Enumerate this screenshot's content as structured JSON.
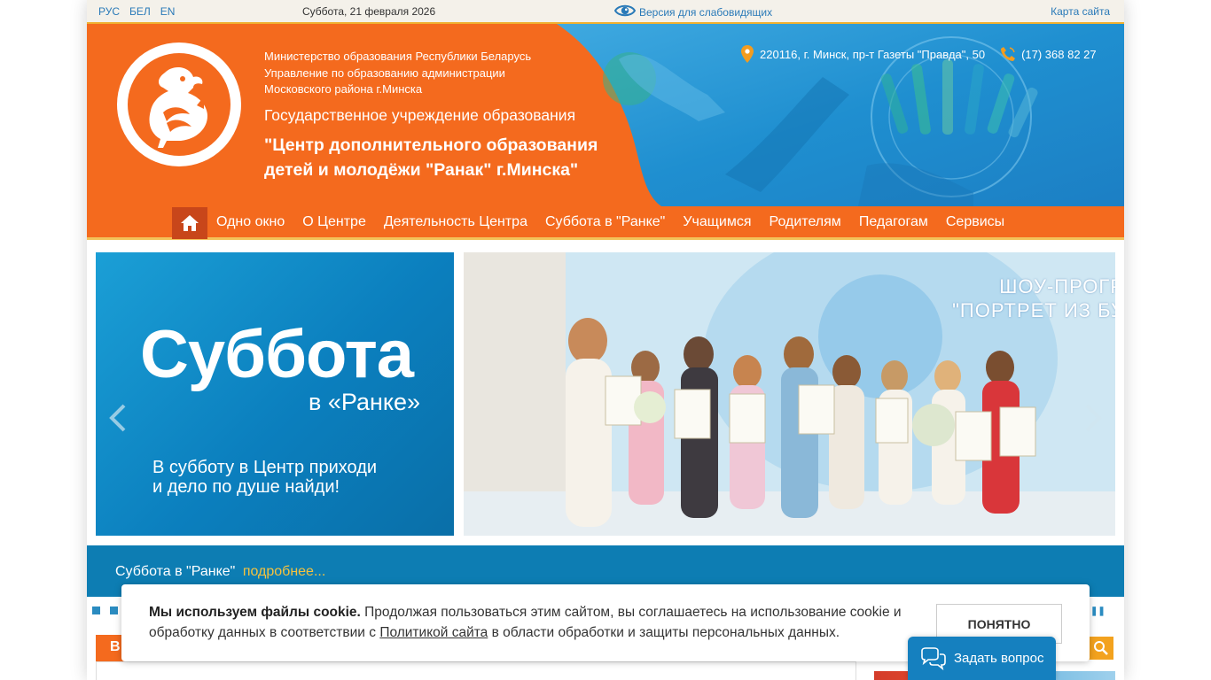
{
  "topbar": {
    "languages": [
      "РУС",
      "БЕЛ",
      "EN"
    ],
    "date": "Суббота, 21 февраля 2026",
    "low_vision": "Версия для слабовидящих",
    "sitemap": "Карта сайта"
  },
  "header": {
    "ministry_lines": [
      "Министерство образования Республики Беларусь",
      "Управление по образованию администрации",
      "Московского района г.Минска"
    ],
    "gov_line": "Государственное учреждение образования",
    "org_name_lines": [
      "\"Центр дополнительного образования",
      "детей и молодёжи \"Ранак\" г.Минска\""
    ],
    "address": "220116, г. Минск, пр-т Газеты \"Правда\", 50",
    "phone": "(17) 368 82 27"
  },
  "nav": {
    "items": [
      "Одно окно",
      "О Центре",
      "Деятельность Центра",
      "Суббота в \"Ранке\"",
      "Учащимся",
      "Родителям",
      "Педагогам",
      "Сервисы"
    ]
  },
  "slider": {
    "left": {
      "big": "Суббота",
      "sub": "в «Ранке»",
      "tagline": [
        "В субботу в Центр приходи",
        "и дело по душе найди!"
      ]
    },
    "right": {
      "title_lines": [
        "ШОУ-ПРОГР",
        "\"ПОРТРЕТ ИЗ БУ"
      ]
    },
    "caption": "Суббота в \"Ранке\"",
    "more": "подробнее..."
  },
  "section": {
    "tab_letter": "В"
  },
  "cookie": {
    "bold": "Мы используем файлы cookie.",
    "text1": " Продолжая пользоваться этим сайтом, вы соглашаетесь на использование cookie и обработку данных в соответствии с ",
    "link": "Политикой сайта",
    "text2": " в области обработки и защиты персональных данных.",
    "button": "ПОНЯТНО"
  },
  "ask": {
    "label": "Задать вопрос"
  },
  "colors": {
    "brand_orange": "#f46a1e",
    "brand_blue": "#0d7db3",
    "accent_yellow": "#f6c23e"
  }
}
